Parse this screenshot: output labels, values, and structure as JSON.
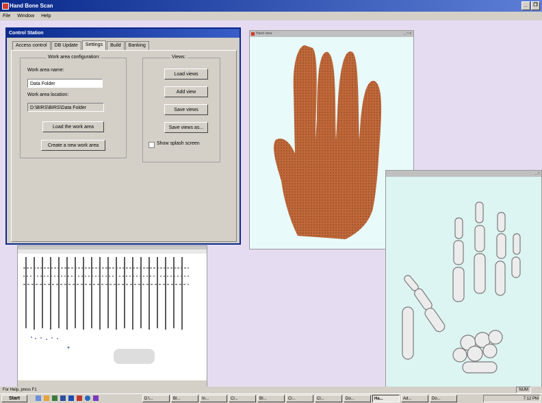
{
  "app": {
    "title": "Hand Bone Scan"
  },
  "menubar": [
    "File",
    "Window",
    "Help"
  ],
  "control_station": {
    "title": "Control Station",
    "tabs": [
      "Access control",
      "DB Update",
      "Settings",
      "Build",
      "Banking"
    ],
    "active_tab": "Settings",
    "work_area": {
      "group_label": "Work area configuration:",
      "name_label": "Work area name:",
      "name_value": "Data Folder",
      "location_label": "Work area location:",
      "location_value": "D:\\BIRS\\BIRS\\Data Folder",
      "load_button": "Load the work area",
      "create_button": "Create a new work area"
    },
    "views": {
      "group_label": "Views:",
      "load_views": "Load views",
      "add_view": "Add view",
      "save_views": "Save views",
      "save_views_as": "Save views as...",
      "splash_label": "Show splash screen",
      "splash_checked": false
    }
  },
  "hand_window": {
    "title": "Hand view",
    "controls": "_ □ x"
  },
  "skeleton_window": {
    "controls": "_ □"
  },
  "status": {
    "text": "For Help, press F1",
    "num": "NUM"
  },
  "taskbar": {
    "start": "Start",
    "tasks": [
      "D:\\...",
      "BI...",
      "In...",
      "Cl...",
      "BI...",
      "Cl...",
      "Cl...",
      "Do...",
      "Ha...",
      "Ad...",
      "Do..."
    ],
    "active_task": "Ha...",
    "clock": "7:12 PM"
  },
  "colors": {
    "titlebar": "#0a2a8c",
    "desktop": "#e6dcf2",
    "hand_points": "#c0683a",
    "bone": "#e6e6e6"
  }
}
